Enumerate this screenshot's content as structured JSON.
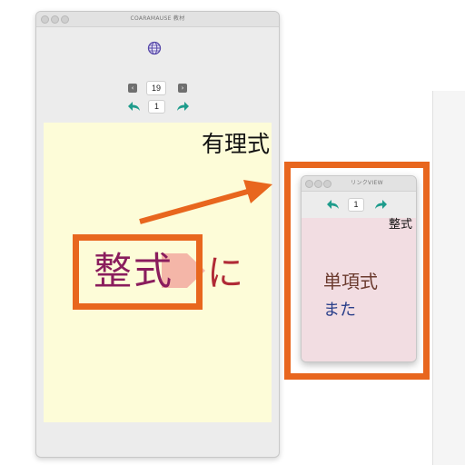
{
  "main_window": {
    "title": "COARAMAUSE 教材",
    "page_counter": "19",
    "link_counter": "1",
    "content_heading": "有理式",
    "highlight_word": "整式",
    "trailing_char": "に"
  },
  "link_window": {
    "title": "リンクVIEW",
    "link_counter": "1",
    "content_heading": "整式",
    "word_line": "単項式",
    "second_line": "また"
  },
  "colors": {
    "accent_orange": "#e8661e",
    "content_bg_main": "#fdfcd8",
    "content_bg_link": "#f2dde2",
    "highlight_word": "#8a1d5d",
    "teal_arrow": "#1e9c8c"
  }
}
